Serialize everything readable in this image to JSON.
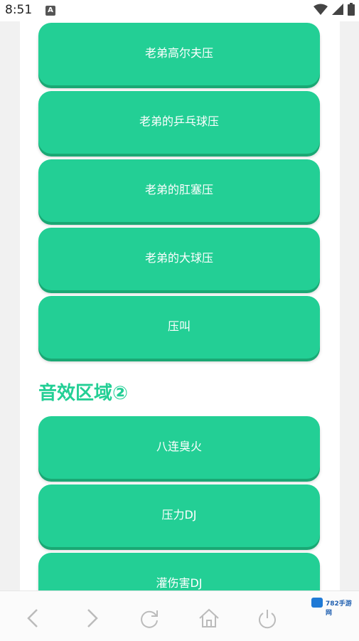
{
  "status_bar": {
    "time": "8:51",
    "notification_badge": "A",
    "icons": [
      "wifi-icon",
      "signal-icon",
      "battery-icon"
    ]
  },
  "buttons_top": [
    {
      "label": "老弟高尔夫压"
    },
    {
      "label": "老弟的乒乓球压"
    },
    {
      "label": "老弟的肛塞压"
    },
    {
      "label": "老弟的大球压"
    },
    {
      "label": "压叫"
    }
  ],
  "section2": {
    "title": "音效区域②",
    "buttons": [
      {
        "label": "八连臭火"
      },
      {
        "label": "压力DJ"
      },
      {
        "label": "灌伤害DJ"
      }
    ]
  },
  "bottom_nav": {
    "items": [
      "back-icon",
      "forward-icon",
      "refresh-icon",
      "home-icon",
      "power-icon"
    ]
  },
  "watermark": {
    "text": "782手游网"
  },
  "colors": {
    "accent": "#23cf95",
    "accent_shadow": "#1aa874",
    "page_bg": "#f1f1f1"
  }
}
